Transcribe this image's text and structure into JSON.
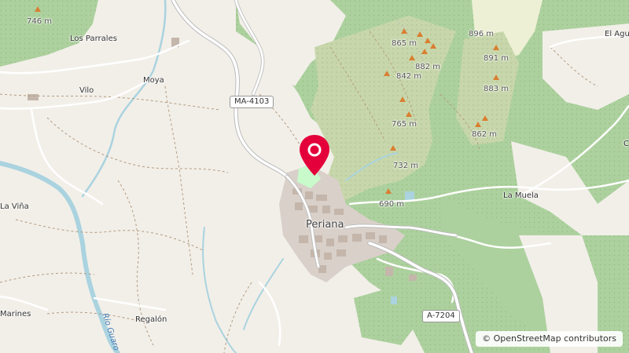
{
  "map": {
    "places": {
      "periana": "Periana",
      "los_parrales": "Los Parrales",
      "moya": "Moya",
      "vilo": "Vilo",
      "la_vina": "La Viña",
      "marines": "Marines",
      "regalon": "Regalón",
      "la_muela": "La Muela",
      "el_agu": "El Agu",
      "edge_c": "C"
    },
    "roads": {
      "ma4103": "MA-4103",
      "a7204": "A-7204"
    },
    "river": "Río Guaro",
    "peaks": {
      "p746": "746 m",
      "p865": "865 m",
      "p882": "882 m",
      "p842": "842 m",
      "p896": "896 m",
      "p891": "891 m",
      "p883": "883 m",
      "p862": "862 m",
      "p765": "765 m",
      "p732": "732 m",
      "p690": "690 m"
    },
    "colors": {
      "land": "#f2efe9",
      "forest": "#add19e",
      "scrub": "#c8d7ab",
      "water": "#aad3df",
      "marker": "#e4003a"
    },
    "marker_icon": "map-pin-icon",
    "attribution": {
      "symbol": "©",
      "text": "OpenStreetMap contributors"
    }
  }
}
